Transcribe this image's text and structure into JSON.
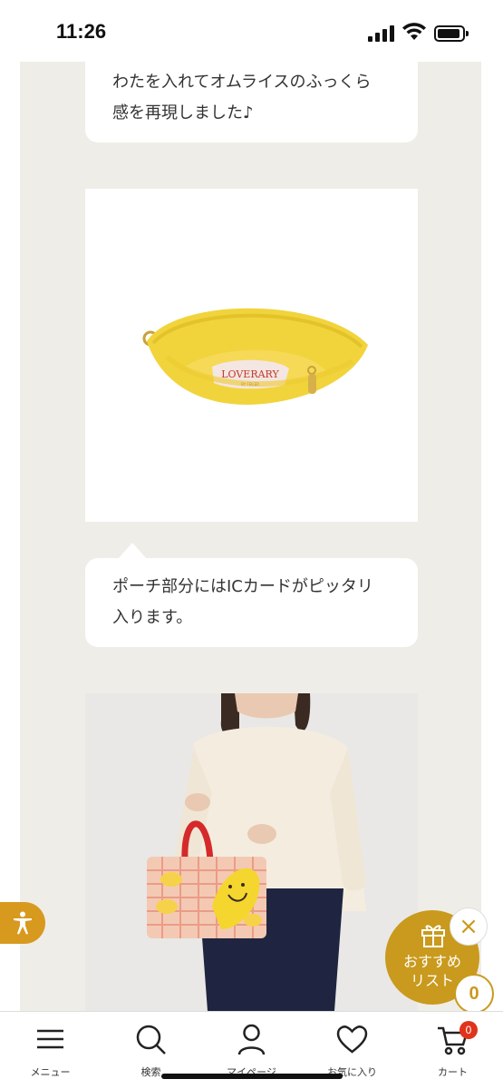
{
  "status_bar": {
    "time": "11:26"
  },
  "article": {
    "bubble_1_lines": [
      "わたを入れてオムライスのふっくら",
      "感を再現しました♪"
    ],
    "pouch_label": "LOVERARY",
    "pouch_sublabel": "BY FEILER",
    "bubble_2_lines": [
      "ポーチ部分にはICカードがピッタリ",
      "入ります。"
    ]
  },
  "recommend": {
    "label_line_1": "おすすめ",
    "label_line_2": "リスト",
    "close": "×",
    "count": "0"
  },
  "bottom_nav": {
    "items": [
      {
        "label": "メニュー",
        "icon": "menu-icon"
      },
      {
        "label": "検索",
        "icon": "search-icon"
      },
      {
        "label": "マイページ",
        "icon": "user-icon"
      },
      {
        "label": "お気に入り",
        "icon": "heart-icon"
      },
      {
        "label": "カート",
        "icon": "cart-icon"
      }
    ],
    "cart_badge": "0"
  },
  "colors": {
    "accent": "#c99a1d",
    "background": "#efede8",
    "badge": "#e0331c",
    "accessibility": "#d8991f"
  }
}
